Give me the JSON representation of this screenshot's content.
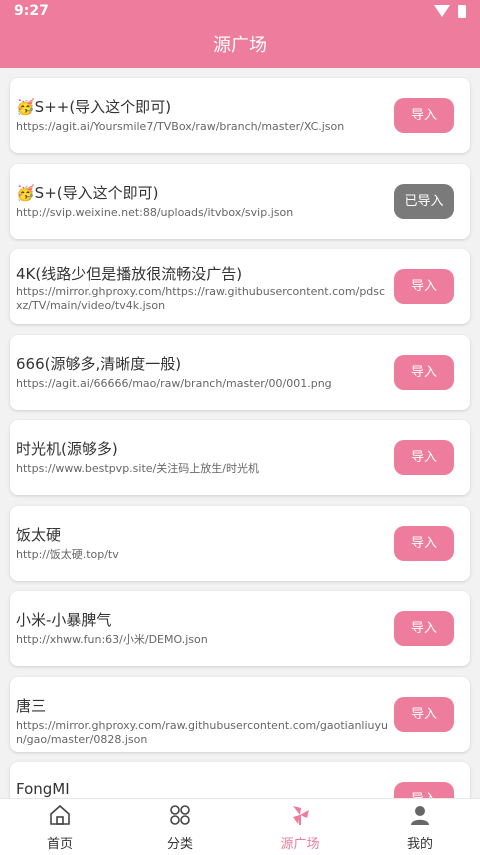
{
  "status": {
    "time": "9:27"
  },
  "appbar": {
    "title": "源广场"
  },
  "sources": [
    {
      "title": "🥳S++(导入这个即可)",
      "url": "https://agit.ai/Yoursmile7/TVBox/raw/branch/master/XC.json",
      "button": "导入",
      "imported": false
    },
    {
      "title": "🥳S+(导入这个即可)",
      "url": "http://svip.weixine.net:88/uploads/itvbox/svip.json",
      "button": "已导入",
      "imported": true
    },
    {
      "title": "4K(线路少但是播放很流畅没广告)",
      "url": "https://mirror.ghproxy.com/https://raw.githubusercontent.com/pdscxz/TV/main/video/tv4k.json",
      "button": "导入",
      "imported": false
    },
    {
      "title": "666(源够多,清晰度一般)",
      "url": "https://agit.ai/66666/mao/raw/branch/master/00/001.png",
      "button": "导入",
      "imported": false
    },
    {
      "title": "时光机(源够多)",
      "url": "https://www.bestpvp.site/关注码上放生/时光机",
      "button": "导入",
      "imported": false
    },
    {
      "title": "饭太硬",
      "url": "http://饭太硬.top/tv",
      "button": "导入",
      "imported": false
    },
    {
      "title": "小米-小暴脾气",
      "url": "http://xhww.fun:63/小米/DEMO.json",
      "button": "导入",
      "imported": false
    },
    {
      "title": "唐三",
      "url": "https://mirror.ghproxy.com/raw.githubusercontent.com/gaotianliuyun/gao/master/0828.json",
      "button": "导入",
      "imported": false
    },
    {
      "title": "FongMI",
      "url": "",
      "button": "导入",
      "imported": false
    }
  ],
  "tabs": [
    {
      "label": "首页",
      "icon": "home-icon",
      "active": false
    },
    {
      "label": "分类",
      "icon": "category-icon",
      "active": false
    },
    {
      "label": "源广场",
      "icon": "source-plaza-icon",
      "active": true
    },
    {
      "label": "我的",
      "icon": "profile-icon",
      "active": false
    }
  ],
  "colors": {
    "accent": "#ee7c9c",
    "imported_button": "#7a7a7a"
  }
}
